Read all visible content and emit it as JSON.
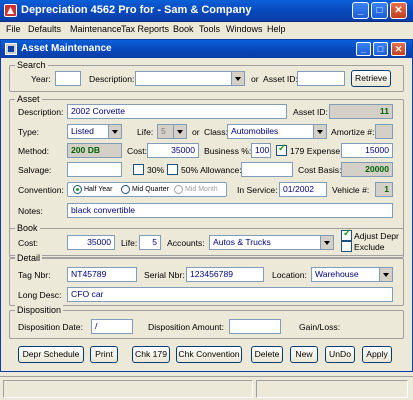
{
  "app": {
    "title": "Depreciation 4562 Pro for  - Sam & Company"
  },
  "menu": [
    "File",
    "Defaults",
    "Maintenance",
    "Tax Reports",
    "Book",
    "Tools",
    "Windows",
    "Help"
  ],
  "window": {
    "title": "Asset Maintenance"
  },
  "search": {
    "legend": "Search",
    "year_label": "Year:",
    "year_value": "",
    "description_label": "Description:",
    "description_value": "",
    "or_label": "or",
    "asset_id_label": "Asset ID:",
    "asset_id_value": "",
    "retrieve_label": "Retrieve"
  },
  "asset": {
    "legend": "Asset",
    "description_label": "Description:",
    "description_value": "2002 Corvette",
    "asset_id_label": "Asset ID:",
    "asset_id_value": "11",
    "type_label": "Type:",
    "type_value": "Listed",
    "life_label": "Life:",
    "life_value": "5",
    "or_label": "or",
    "class_label": "Class:",
    "class_value": "Automobiles",
    "amortize_label": "Amortize #:",
    "amortize_value": "",
    "method_label": "Method:",
    "method_value": "200 DB",
    "cost_label": "Cost:",
    "cost_value": "35000",
    "business_label": "Business %:",
    "business_value": "100",
    "expense179_label": "179 Expense:",
    "expense179_value": "15000",
    "salvage_label": "Salvage:",
    "salvage_value": "",
    "pct30_label": "30%",
    "pct50_label": "50% Allowance:",
    "pct50_value": "",
    "cost_basis_label": "Cost Basis:",
    "cost_basis_value": "20000",
    "convention_label": "Convention:",
    "conventions": [
      "Half Year",
      "Mid Quarter",
      "Mid Month"
    ],
    "in_service_label": "In Service:",
    "in_service_value": "01/2002",
    "vehicle_label": "Vehicle #:",
    "vehicle_value": "1",
    "notes_label": "Notes:",
    "notes_value": "black convertible"
  },
  "book": {
    "legend": "Book",
    "cost_label": "Cost:",
    "cost_value": "35000",
    "life_label": "Life:",
    "life_value": "5",
    "accounts_label": "Accounts:",
    "accounts_value": "Autos & Trucks",
    "adjust_label": "Adjust Depr",
    "exclude_label": "Exclude"
  },
  "detail": {
    "legend": "Detail",
    "tag_label": "Tag Nbr:",
    "tag_value": "NT45789",
    "serial_label": "Serial Nbr:",
    "serial_value": "123456789",
    "location_label": "Location:",
    "location_value": "Warehouse",
    "long_desc_label": "Long Desc:",
    "long_desc_value": "CFO car"
  },
  "disposition": {
    "legend": "Disposition",
    "date_label": "Disposition Date:",
    "date_value": " /",
    "amount_label": "Disposition Amount:",
    "amount_value": "",
    "gain_label": "Gain/Loss:",
    "gain_value": ""
  },
  "buttons": [
    "Depr Schedule",
    "Print",
    "Chk 179",
    "Chk Convention",
    "Delete",
    "New",
    "UnDo",
    "Apply"
  ],
  "colors": {
    "titlebar": "#0a4fc8",
    "field_text": "#000080",
    "readonly_value": "#006400"
  }
}
